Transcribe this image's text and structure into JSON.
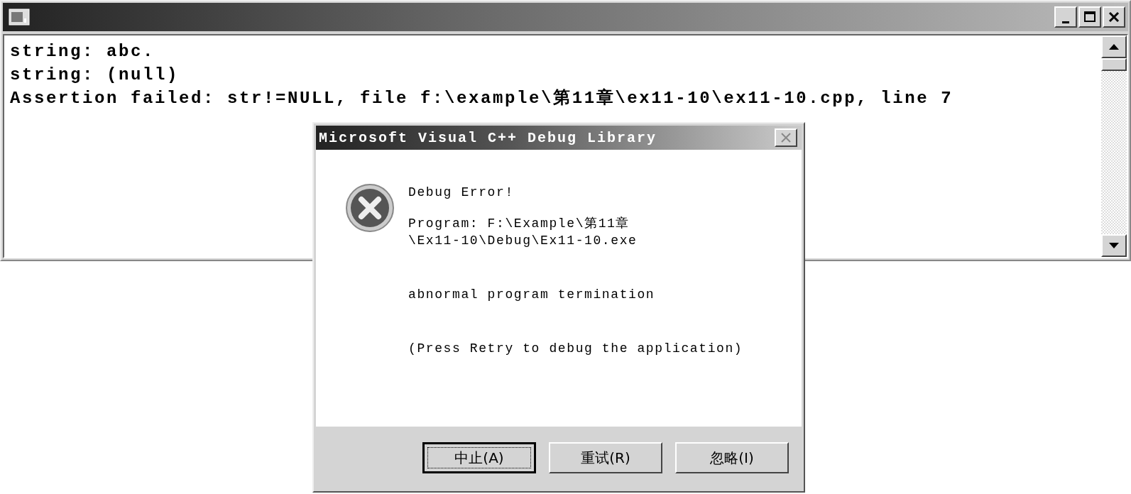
{
  "console": {
    "lines": [
      "string: abc.",
      "string: (null)",
      "Assertion failed: str!=NULL, file f:\\example\\第11章\\ex11-10\\ex11-10.cpp, line 7"
    ]
  },
  "dialog": {
    "title": "Microsoft Visual C++ Debug Library",
    "heading": "Debug Error!",
    "program_lines": [
      "Program: F:\\Example\\第11章",
      "\\Ex11-10\\Debug\\Ex11-10.exe"
    ],
    "message": "abnormal program termination",
    "hint": "(Press Retry to debug the application)",
    "buttons": [
      {
        "label": "中止(A)",
        "selected": true
      },
      {
        "label": "重试(R)",
        "selected": false
      },
      {
        "label": "忽略(I)",
        "selected": false
      }
    ]
  }
}
